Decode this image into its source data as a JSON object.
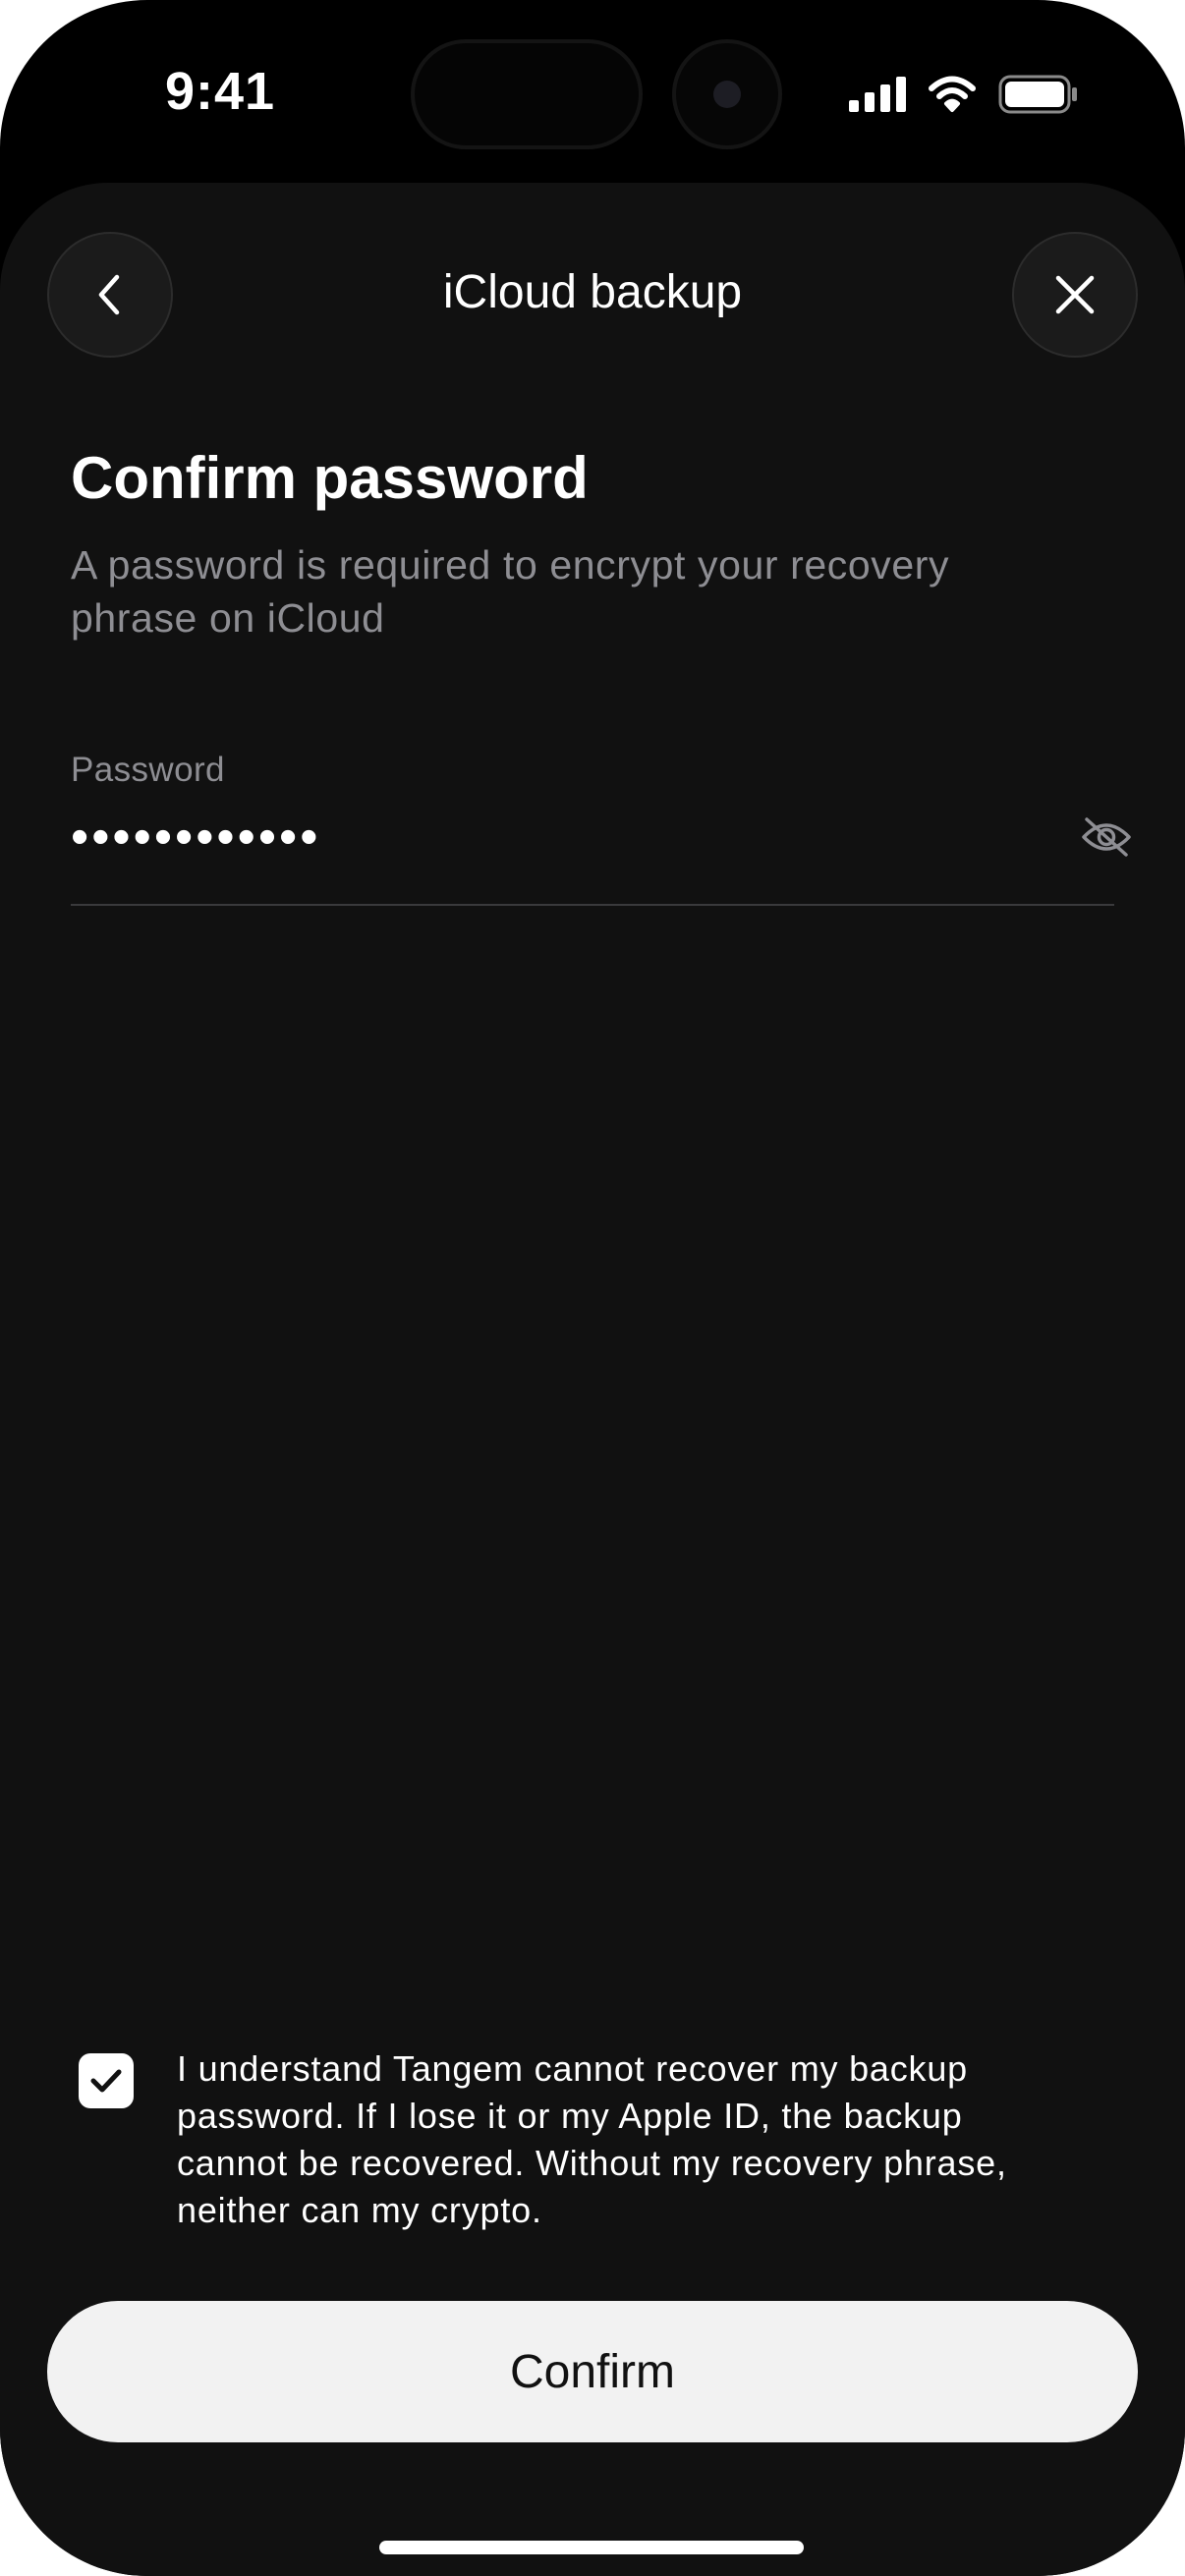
{
  "status_bar": {
    "time": "9:41",
    "icons": [
      "cellular-signal-icon",
      "wifi-icon",
      "battery-icon"
    ]
  },
  "nav": {
    "title": "iCloud backup",
    "back_icon": "chevron-left-icon",
    "close_icon": "close-icon"
  },
  "content": {
    "title": "Confirm password",
    "subtitle": "A password is required to encrypt your recovery phrase on iCloud"
  },
  "password_field": {
    "label": "Password",
    "value": "••••••••••••",
    "visibility_icon": "eye-slash-icon"
  },
  "consent": {
    "checked": true,
    "text": "I understand Tangem cannot recover my backup password. If I lose it or my Apple ID, the backup cannot be recovered. Without my recovery phrase, neither can my crypto."
  },
  "actions": {
    "confirm_label": "Confirm"
  },
  "colors": {
    "sheet_background": "#111111",
    "button_background": "#f2f2f2",
    "secondary_text": "#8e8e93"
  }
}
